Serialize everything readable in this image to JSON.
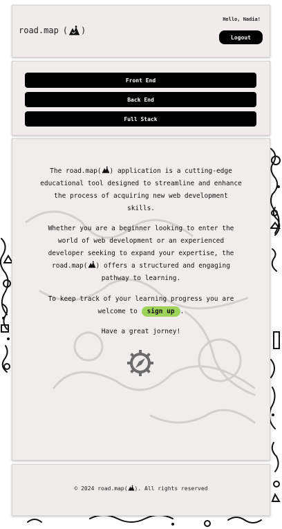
{
  "header": {
    "brand_name": "road.map",
    "brand_open": "(",
    "brand_close": ")",
    "greeting": "Hello, Nadia!",
    "logout_label": "Logout"
  },
  "tracks": {
    "items": [
      {
        "label": "Front End"
      },
      {
        "label": "Back End"
      },
      {
        "label": "Full Stack"
      }
    ]
  },
  "about": {
    "p1_before": "The road.map(",
    "p1_after": ") application is a cutting-edge educational tool designed to streamline and enhance the process of acquiring new web development skills.",
    "p2_before": "Whether you are a beginner looking to enter the world of web development or an experienced developer seeking to expand your expertise, the road.map(",
    "p2_after": ") offers a structured and engaging pathway to learning.",
    "p3_before": "To keep track of your learning progress you are welcome to ",
    "signup_label": "sign up",
    "p3_after": ".",
    "p4": "Have a great jorney!"
  },
  "footer": {
    "copyright_before": "© 2024 road.map(",
    "copyright_after": "). All rights reserved"
  },
  "colors": {
    "card_background": "#efeceb",
    "button_background": "#000000",
    "button_text": "#ffffff",
    "signup_accent": "#9ed35a",
    "compass": "#6b6b6b"
  },
  "icons": {
    "logo": "hiker-mountain-icon",
    "compass": "compass-icon"
  }
}
